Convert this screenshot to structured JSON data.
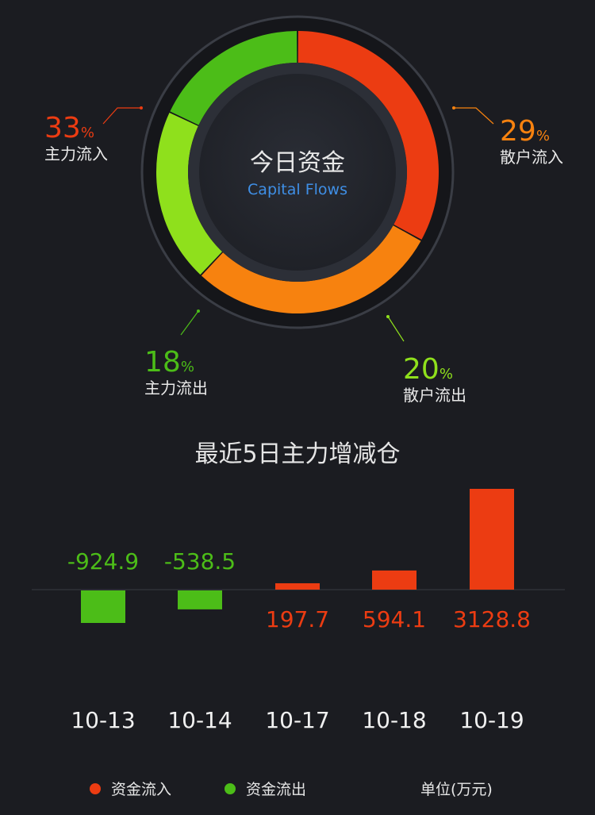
{
  "donut": {
    "center_title": "今日资金",
    "center_subtitle": "Capital Flows",
    "segments": [
      {
        "key": "main_in",
        "pct": "33",
        "unit": "%",
        "label": "主力流入",
        "color": "#ec3c12"
      },
      {
        "key": "retail_in",
        "pct": "29",
        "unit": "%",
        "label": "散户流入",
        "color": "#f7820f"
      },
      {
        "key": "retail_out",
        "pct": "20",
        "unit": "%",
        "label": "散户流出",
        "color": "#8fe01c"
      },
      {
        "key": "main_out",
        "pct": "18",
        "unit": "%",
        "label": "主力流出",
        "color": "#4cbd18"
      }
    ]
  },
  "bar_section": {
    "title": "最近5日主力增减仓",
    "unit_label": "单位(万元)",
    "legend": [
      {
        "label": "资金流入",
        "color": "#ec3c12"
      },
      {
        "label": "资金流出",
        "color": "#4cbd18"
      }
    ]
  },
  "chart_data": {
    "type": "bar",
    "title": "最近5日主力增减仓",
    "categories": [
      "10-13",
      "10-14",
      "10-17",
      "10-18",
      "10-19"
    ],
    "values": [
      -924.9,
      -538.5,
      197.7,
      594.1,
      3128.8
    ],
    "value_labels": [
      "-924.9",
      "-538.5",
      "197.7",
      "594.1",
      "3128.8"
    ],
    "ylabel": "单位(万元)",
    "colors": {
      "positive": "#ec3c12",
      "negative": "#4cbd18"
    },
    "grid": false,
    "legend_position": "bottom"
  }
}
